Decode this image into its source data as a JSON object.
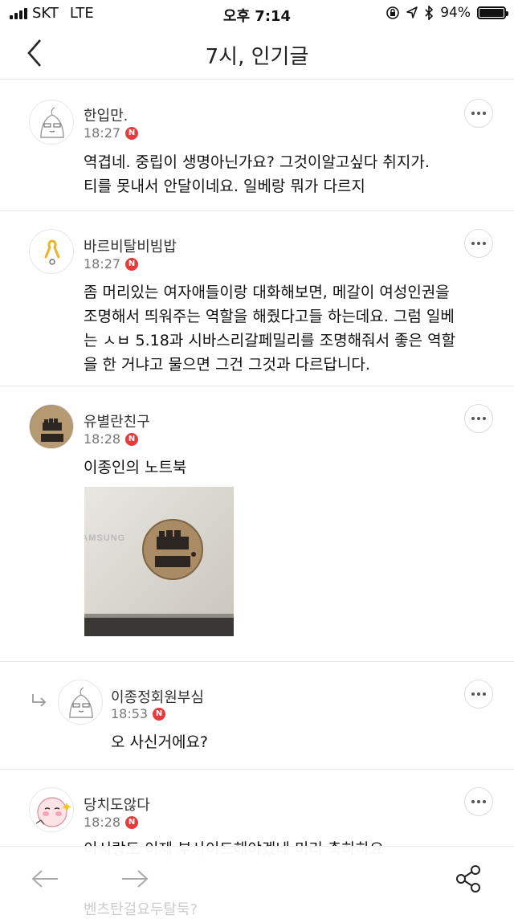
{
  "status_bar": {
    "carrier": "SKT",
    "network": "LTE",
    "time": "오후 7:14",
    "battery": "94%",
    "battery_level": 0.94
  },
  "header": {
    "title": "7시, 인기글"
  },
  "comments": [
    {
      "nickname": "한입만.",
      "time": "18:27",
      "badge": "N",
      "text_lines": [
        "역겹네. 중립이 생명아닌가요? 그것이알고싶다 취지가.",
        "티를 못내서 안달이네요. 일베랑 뭐가 다르지"
      ]
    },
    {
      "nickname": "바르비탈비빔밥",
      "time": "18:27",
      "badge": "N",
      "text_lines": [
        "좀 머리있는 여자애들이랑 대화해보면, 메갈이 여성인권을",
        "조명해서 띄워주는 역할을 해줬다고들 하는데요. 그럼 일베",
        "는 ㅅㅂ 5.18과 시바스리갈페밀리를 조명해줘서 좋은 역할",
        "을 한 거냐고 물으면 그건 그것과 다르답니다."
      ]
    },
    {
      "nickname": "유별란친구",
      "time": "18:28",
      "badge": "N",
      "text_lines": [
        "이종인의 노트북"
      ],
      "photo_label": "SAMSUNG"
    },
    {
      "nickname": "이종정회원부심",
      "time": "18:53",
      "badge": "N",
      "is_reply": true,
      "text_lines": [
        "오 사신거에요?"
      ]
    },
    {
      "nickname": "당치도않다",
      "time": "18:28",
      "badge": "N",
      "text_lines": [
        "이시랑도 이제 부사이드해야겠네 미리 축하하요"
      ]
    }
  ],
  "partial_next": "벤츠탄걸요두탈둑?",
  "icons": {
    "back": "chevron-left-icon",
    "more": "more-options-icon",
    "reply": "reply-arrow-icon",
    "prev": "arrow-left-icon",
    "next": "arrow-right-icon",
    "share": "share-icon"
  },
  "colors": {
    "badge": "#e8393b",
    "divider": "#e8e8e8",
    "muted": "#777777"
  }
}
